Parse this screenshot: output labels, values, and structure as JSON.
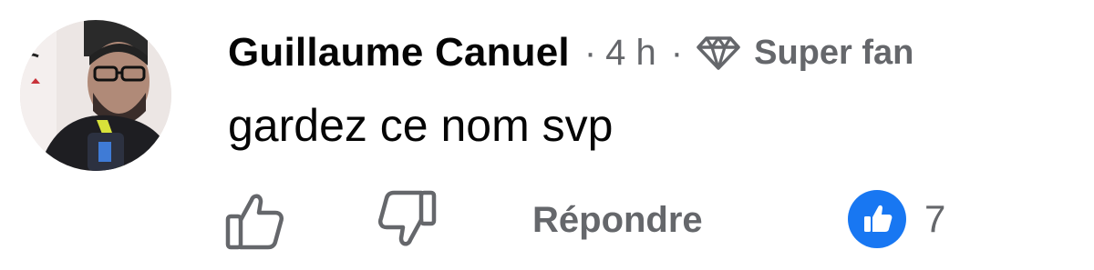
{
  "comment": {
    "author": "Guillaume Canuel",
    "separator": "·",
    "time": "4 h",
    "badge": {
      "icon": "diamond-icon",
      "label": "Super fan"
    },
    "text": "gardez ce nom svp"
  },
  "actions": {
    "like_icon": "thumbs-up-outline-icon",
    "dislike_icon": "thumbs-down-outline-icon",
    "reply_label": "Répondre"
  },
  "reactions": {
    "icon": "like-reaction-icon",
    "count": "7",
    "color": "#1877f2"
  },
  "colors": {
    "primary_text": "#050505",
    "secondary_text": "#65676b"
  }
}
